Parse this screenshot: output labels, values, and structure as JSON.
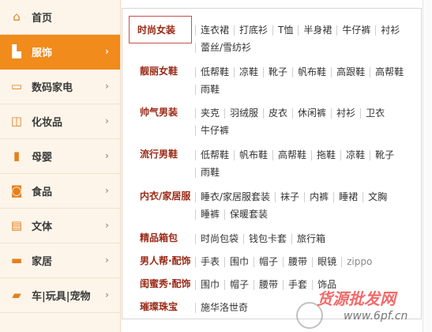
{
  "sidebar": {
    "items": [
      {
        "label": "首页",
        "icon": "home-icon",
        "glyph": "⌂"
      },
      {
        "label": "服饰",
        "icon": "clothing-icon",
        "glyph": "▙"
      },
      {
        "label": "数码家电",
        "icon": "monitor-icon",
        "glyph": "▭"
      },
      {
        "label": "化妆品",
        "icon": "cosmetics-icon",
        "glyph": "◫"
      },
      {
        "label": "母婴",
        "icon": "bottle-icon",
        "glyph": "▮"
      },
      {
        "label": "食品",
        "icon": "cup-icon",
        "glyph": "◙"
      },
      {
        "label": "文体",
        "icon": "book-icon",
        "glyph": "▤"
      },
      {
        "label": "家居",
        "icon": "bed-icon",
        "glyph": "▬"
      },
      {
        "label": "车|玩具|宠物",
        "icon": "car-icon",
        "glyph": "▰"
      }
    ],
    "arrow": "›"
  },
  "menu": {
    "rows": [
      {
        "category": "时尚女装",
        "links": [
          "连衣裙",
          "打底衫",
          "T恤",
          "半身裙",
          "牛仔裤",
          "衬衫",
          "蕾丝/雪纺衫"
        ]
      },
      {
        "category": "靓丽女鞋",
        "links": [
          "低帮鞋",
          "凉鞋",
          "靴子",
          "帆布鞋",
          "高跟鞋",
          "高帮鞋",
          "雨鞋"
        ]
      },
      {
        "category": "帅气男装",
        "links": [
          "夹克",
          "羽绒服",
          "皮衣",
          "休闲裤",
          "衬衫",
          "卫衣",
          "牛仔裤"
        ]
      },
      {
        "category": "流行男鞋",
        "links": [
          "低帮鞋",
          "帆布鞋",
          "高帮鞋",
          "拖鞋",
          "凉鞋",
          "靴子",
          "雨鞋"
        ]
      },
      {
        "category": "内衣/家居服",
        "links": [
          "睡衣/家居服套装",
          "袜子",
          "内裤",
          "睡裙",
          "文胸",
          "睡裤",
          "保暖套装"
        ]
      },
      {
        "category": "精品箱包",
        "links": [
          "时尚包袋",
          "钱包卡套",
          "旅行箱"
        ]
      },
      {
        "category": "男人帮·配饰",
        "links": [
          "手表",
          "围巾",
          "帽子",
          "腰带",
          "眼镜",
          "zippo"
        ]
      },
      {
        "category": "闺蜜秀·配饰",
        "links": [
          "围巾",
          "帽子",
          "腰带",
          "手套",
          "饰品"
        ]
      },
      {
        "category": "璀璨珠宝",
        "links": [
          "施华洛世奇"
        ]
      }
    ]
  },
  "watermark": {
    "line1": "货源批发网",
    "line2": "www.6pf.cn"
  },
  "colors": {
    "accent": "#f08b1c",
    "category": "#9a2a17",
    "link": "#333333"
  }
}
